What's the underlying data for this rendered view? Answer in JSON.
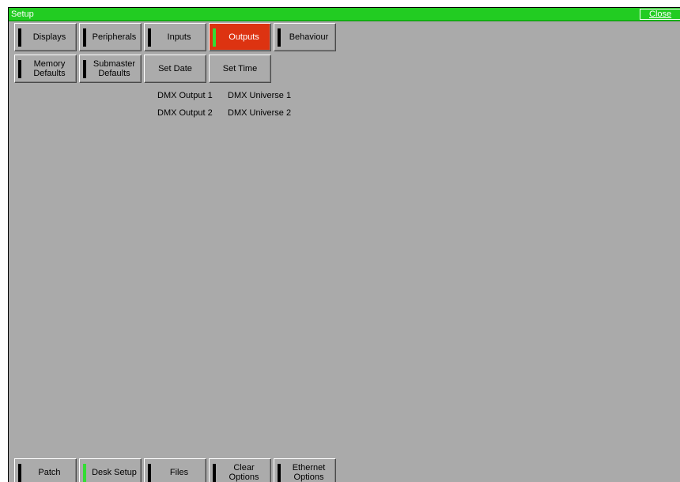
{
  "window": {
    "title": "Setup",
    "close_label": "Close"
  },
  "tabs_row1": [
    {
      "label": "Displays",
      "indicator": "black"
    },
    {
      "label": "Peripherals",
      "indicator": "black"
    },
    {
      "label": "Inputs",
      "indicator": "black"
    },
    {
      "label": "Outputs",
      "indicator": "green",
      "active": true
    },
    {
      "label": "Behaviour",
      "indicator": "black"
    }
  ],
  "tabs_row2": [
    {
      "label": "Memory\nDefaults",
      "indicator": "black"
    },
    {
      "label": "Submaster\nDefaults",
      "indicator": "black"
    },
    {
      "label": "Set Date"
    },
    {
      "label": "Set Time"
    }
  ],
  "outputs": [
    {
      "output": "DMX Output 1",
      "universe": "DMX Universe 1"
    },
    {
      "output": "DMX Output 2",
      "universe": "DMX Universe 2"
    }
  ],
  "bottom_bar": [
    {
      "label": "Patch",
      "indicator": "black"
    },
    {
      "label": "Desk Setup",
      "indicator": "green"
    },
    {
      "label": "Files",
      "indicator": "black"
    },
    {
      "label": "Clear\nOptions",
      "indicator": "black"
    },
    {
      "label": "Ethernet\nOptions",
      "indicator": "black"
    }
  ],
  "colors": {
    "titlebar": "#22cc22",
    "background": "#aaaaaa",
    "active_button": "#dd3311",
    "indicator_on": "#33dd33",
    "indicator_off": "#000000"
  }
}
